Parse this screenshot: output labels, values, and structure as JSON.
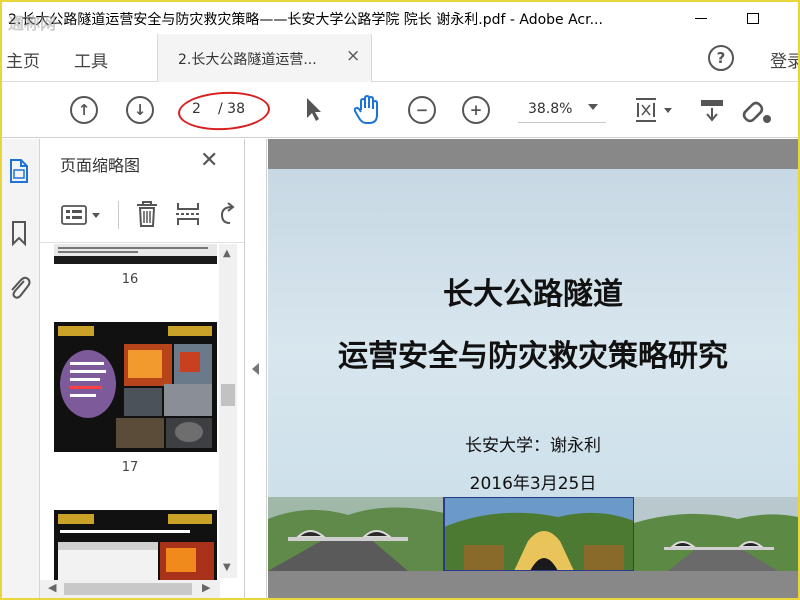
{
  "window": {
    "title": "2.长大公路隧道运营安全与防灾救灾策略——长安大学公路学院 院长 谢永利.pdf - Adobe Acr...",
    "watermark": "通称网"
  },
  "menu": {
    "home": "主页",
    "tools": "工具",
    "doc_tab": "2.长大公路隧道运营...",
    "close_symbol": "×",
    "help_symbol": "?",
    "login": "登录"
  },
  "toolbar": {
    "current_page": "2",
    "total_pages": "/ 38",
    "zoom": "38.8%",
    "prev_symbol": "↑",
    "next_symbol": "↓",
    "zoom_out_symbol": "−",
    "zoom_in_symbol": "+",
    "highlight_color": "#d82020"
  },
  "sidebar": {
    "title": "页面缩略图",
    "close_symbol": "✕",
    "thumbnails": [
      {
        "page": "16"
      },
      {
        "page": "17"
      }
    ]
  },
  "slide": {
    "title_line1": "长大公路隧道",
    "title_line2": "运营安全与防灾救灾策略研究",
    "author": "长安大学：谢永利",
    "date": "2016年3月25日"
  },
  "icons": [
    "arrow-up-icon",
    "arrow-down-icon",
    "select-cursor-icon",
    "hand-icon",
    "zoom-out-icon",
    "zoom-in-icon",
    "fit-page-icon",
    "scroll-mode-icon",
    "link-icon",
    "thumbnails-icon",
    "bookmark-icon",
    "attachment-icon",
    "options-icon",
    "delete-icon",
    "insert-icon",
    "rotate-icon"
  ]
}
